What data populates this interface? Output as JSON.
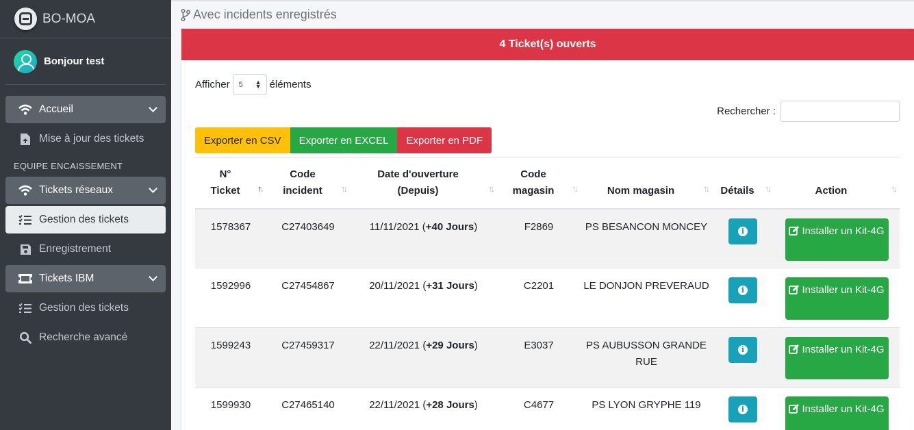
{
  "brand": {
    "name": "BO-MOA"
  },
  "user": {
    "greeting": "Bonjour test"
  },
  "sidebar": {
    "items": [
      {
        "label": "Accueil",
        "icon": "wifi-icon",
        "state": "open"
      },
      {
        "label": "Mise à jour des tickets",
        "icon": "file-upload-icon",
        "state": "normal"
      },
      {
        "header": "EQUIPE ENCAISSEMENT"
      },
      {
        "label": "Tickets réseaux",
        "icon": "wifi-icon",
        "state": "open"
      },
      {
        "label": "Gestion des tickets",
        "icon": "list-icon",
        "state": "active"
      },
      {
        "label": "Enregistrement",
        "icon": "save-icon",
        "state": "normal"
      },
      {
        "label": "Tickets IBM",
        "icon": "ticket-icon",
        "state": "open"
      },
      {
        "label": "Gestion des tickets",
        "icon": "list-icon",
        "state": "normal"
      },
      {
        "label": "Recherche avancé",
        "icon": "search-icon",
        "state": "normal"
      }
    ]
  },
  "page": {
    "breadcrumb": "Avec incidents enregistrés"
  },
  "card": {
    "header": "4 Ticket(s) ouverts"
  },
  "controls": {
    "show_prefix": "Afficher",
    "show_value": "5",
    "show_suffix": "éléments",
    "search_label": "Rechercher :",
    "search_value": ""
  },
  "export": {
    "csv": "Exporter en CSV",
    "excel": "Exporter en EXCEL",
    "pdf": "Exporter en PDF"
  },
  "table": {
    "columns": [
      {
        "line1": "N°",
        "line2": "Ticket"
      },
      {
        "line1": "Code",
        "line2": "incident"
      },
      {
        "line1": "Date d'ouverture",
        "line2": "(Depuis)"
      },
      {
        "line1": "Code",
        "line2": "magasin"
      },
      {
        "line1": "",
        "line2": "Nom magasin"
      },
      {
        "line1": "",
        "line2": "Détails"
      },
      {
        "line1": "",
        "line2": "Action"
      }
    ],
    "rows": [
      {
        "ticket": "1578367",
        "incident": "C27403649",
        "date": "11/11/2021",
        "since": "+40 Jours",
        "magasin": "F2869",
        "nom": "PS BESANCON MONCEY",
        "action": "Installer un Kit-4G"
      },
      {
        "ticket": "1592996",
        "incident": "C27454867",
        "date": "20/11/2021",
        "since": "+31 Jours",
        "magasin": "C2201",
        "nom": "LE DONJON PREVERAUD",
        "action": "Installer un Kit-4G"
      },
      {
        "ticket": "1599243",
        "incident": "C27459317",
        "date": "22/11/2021",
        "since": "+29 Jours",
        "magasin": "E3037",
        "nom": "PS AUBUSSON GRANDE RUE",
        "action": "Installer un Kit-4G"
      },
      {
        "ticket": "1599930",
        "incident": "C27465140",
        "date": "22/11/2021",
        "since": "+28 Jours",
        "magasin": "C4677",
        "nom": "PS LYON GRYPHE 119",
        "action": "Installer un Kit-4G"
      }
    ]
  },
  "colors": {
    "sidebar": "#343a40",
    "danger": "#dc3545",
    "success": "#28a745",
    "warning": "#ffc107",
    "info": "#17a2b8"
  }
}
